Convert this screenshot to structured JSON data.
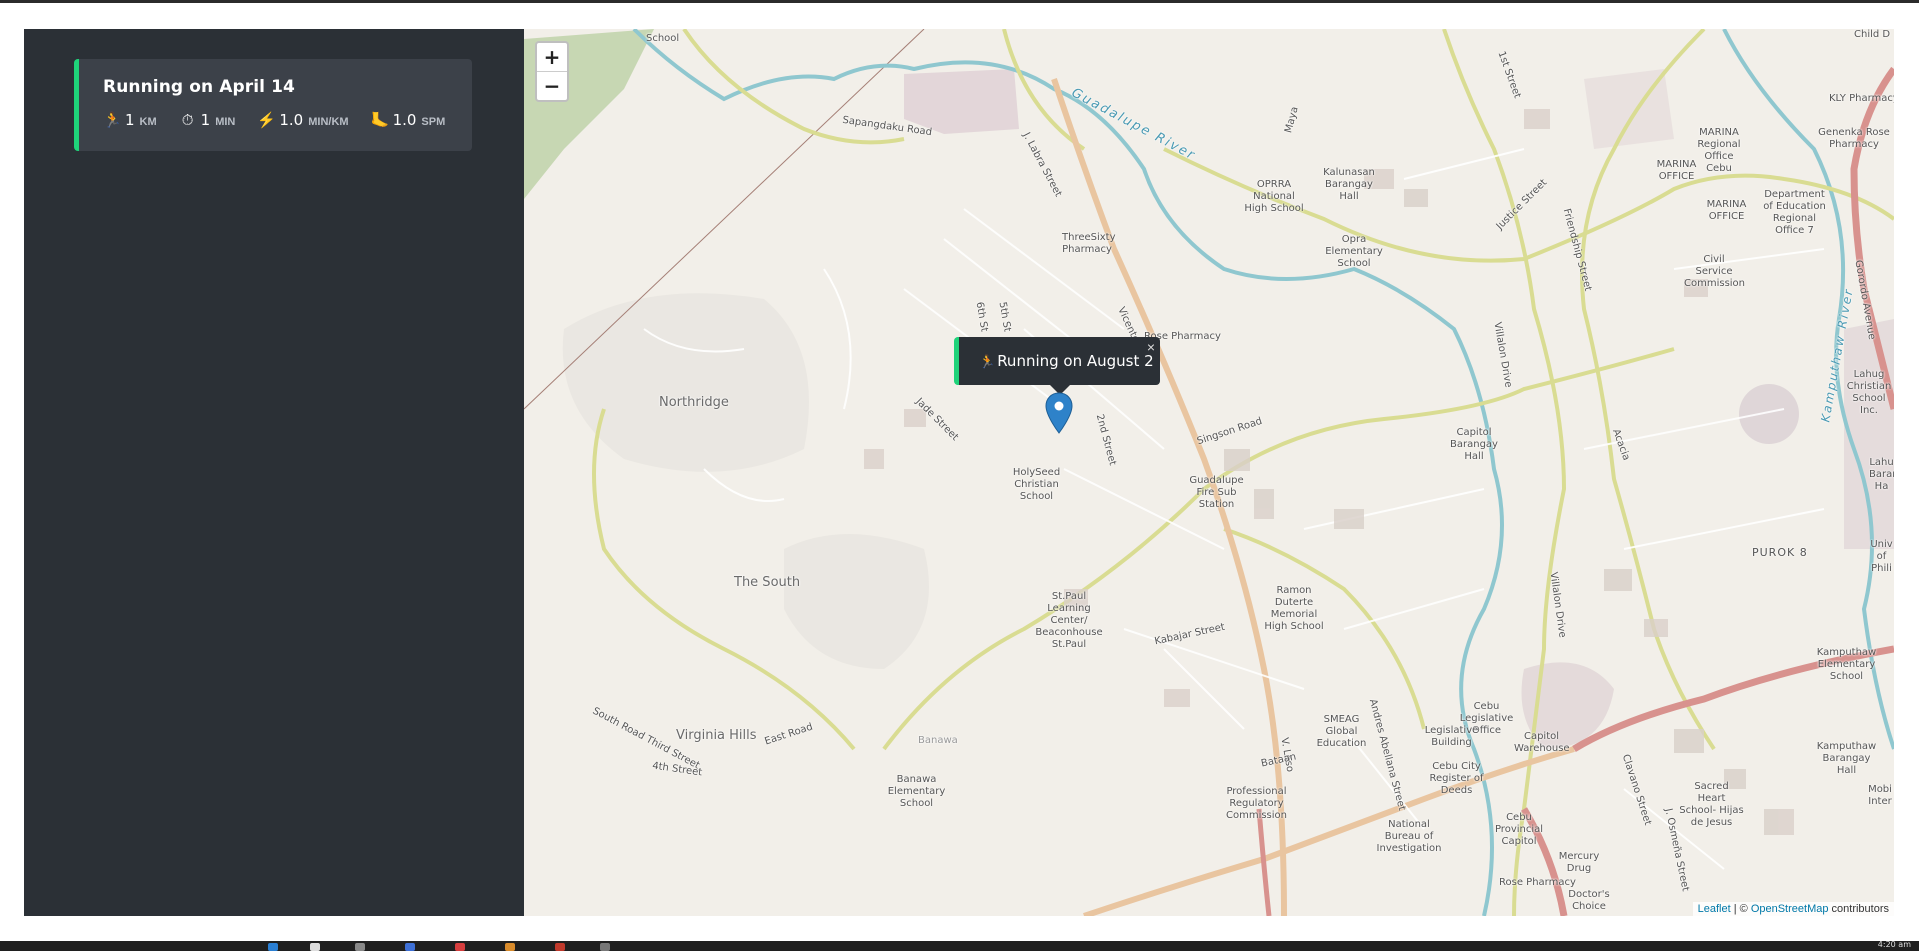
{
  "sidebar": {
    "card": {
      "title": "Running on April 14",
      "stats": [
        {
          "icon": "runner-icon",
          "value": "1",
          "unit": "KM"
        },
        {
          "icon": "stopwatch-icon",
          "value": "1",
          "unit": "MIN"
        },
        {
          "icon": "lightning-icon",
          "value": "1.0",
          "unit": "MIN/KM"
        },
        {
          "icon": "foot-icon",
          "value": "1.0",
          "unit": "SPM"
        }
      ]
    }
  },
  "map": {
    "zoom_in": "+",
    "zoom_out": "−",
    "popup": {
      "text": "Running on August 2",
      "close": "×"
    },
    "labels": {
      "school_top": "School",
      "sapangdaku": "Sapangdaku Road",
      "j_labra": "J. Labra Street",
      "guadalupe_river": "Guadalupe River",
      "maya": "Maya",
      "oprra": "OPRRA National High School",
      "kalunasan": "Kalunasan Barangay Hall",
      "opra_elem": "Opra Elementary School",
      "first_street": "1st Street",
      "justice": "Justice Street",
      "friendship": "Friendship Street",
      "marina_regional": "MARINA Regional Office Cebu",
      "marina_office": "MARINA OFFICE",
      "marina_office2": "MARINA OFFICE",
      "kly": "KLY Pharmacy",
      "genenka": "Genenka Rose Pharmacy",
      "child": "Child D",
      "deped": "Department of Education Regional Office 7",
      "civil": "Civil Service Commission",
      "gorordo": "Gorordo Avenue",
      "kamputhaw_river": "Kamputhaw River",
      "lahug": "Lahug Christian School Inc.",
      "threesixty": "ThreeSixty Pharmacy",
      "rose_pharmacy_mid": "Rose Pharmacy",
      "sixth": "6th St",
      "fifth": "5th St",
      "vicente": "Vicente",
      "northridge": "Northridge",
      "jade": "Jade Street",
      "holyseed": "HolySeed Christian School",
      "second": "2nd Street",
      "singson": "Singson Road",
      "villalon": "Villalon Drive",
      "capitol_brgy": "Capitol Barangay Hall",
      "acacia": "Acacia",
      "guadalupe_fire": "Guadalupe Fire Sub Station",
      "purok8": "PUROK 8",
      "the_south": "The South",
      "st_paul": "St.Paul Learning Center/ Beaconhouse St.Paul",
      "ramon": "Ramon Duterte Memorial High School",
      "kabajar": "Kabajar Street",
      "villalon2": "Villalon Drive",
      "kamputhaw_elem": "Kamputhaw Elementary School",
      "south_road": "South Road Third Street",
      "fourth": "4th Street",
      "virginia": "Virginia Hills",
      "east_road": "East Road",
      "banawa": "Banawa",
      "banawa_elem": "Banawa Elementary School",
      "smeag": "SMEAG Global Education",
      "andres": "Andres Abellana Street",
      "v_loso": "V. Loso",
      "bataan": "Bataan",
      "prc": "Professional Regulatory Commission",
      "cebu_legislative": "Cebu Legislative Office",
      "legislative_bldg": "Legislative Building",
      "capitol_warehouse": "Capitol Warehouse",
      "cebu_city_reg": "Cebu City Register of Deeds",
      "cebu_provincial": "Cebu Provincial Capitol",
      "nbi": "National Bureau of Investigation",
      "mercury": "Mercury Drug",
      "rose_pharmacy": "Rose Pharmacy",
      "doctors": "Doctor's Choice",
      "clavano": "Clavano Street",
      "osmena": "J. Osmeña Street",
      "sacred": "Sacred Heart School- Hijas de Jesus",
      "kamputhaw_brgy": "Kamputhaw Barangay Hall",
      "mobi": "Mobi Inter",
      "univ": "Univ of Phili",
      "lahug2": "Lahu Barang Ha"
    },
    "attribution": {
      "leaflet": "Leaflet",
      "sep": " | © ",
      "osm": "OpenStreetMap",
      "tail": " contributors"
    }
  },
  "taskbar": {
    "clock": "4:20 am"
  }
}
